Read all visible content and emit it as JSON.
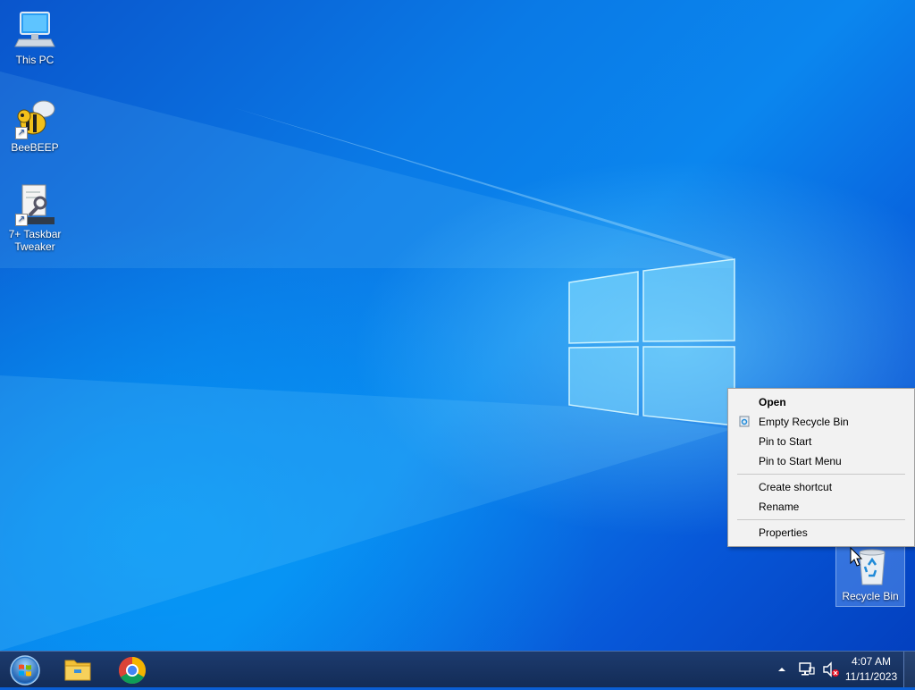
{
  "desktop": {
    "icons": [
      {
        "label": "This PC"
      },
      {
        "label": "BeeBEEP"
      },
      {
        "label": "7+ Taskbar Tweaker"
      },
      {
        "label": "Recycle Bin"
      }
    ]
  },
  "context_menu": {
    "items": [
      {
        "label": "Open",
        "bold": true
      },
      {
        "label": "Empty Recycle Bin",
        "icon": "recycle-bin-icon"
      },
      {
        "label": "Pin to Start"
      },
      {
        "label": "Pin to Start Menu"
      },
      {
        "label": "Create shortcut"
      },
      {
        "label": "Rename"
      },
      {
        "label": "Properties"
      }
    ]
  },
  "taskbar": {
    "buttons": [
      {
        "name": "start-button",
        "icon": "windows-orb-icon"
      },
      {
        "name": "file-explorer",
        "icon": "folder-icon"
      },
      {
        "name": "chrome",
        "icon": "chrome-icon"
      }
    ],
    "tray": {
      "time": "4:07 AM",
      "date": "11/11/2023",
      "icons": [
        "chevron-up-icon",
        "network-icon",
        "volume-muted-icon"
      ]
    }
  }
}
